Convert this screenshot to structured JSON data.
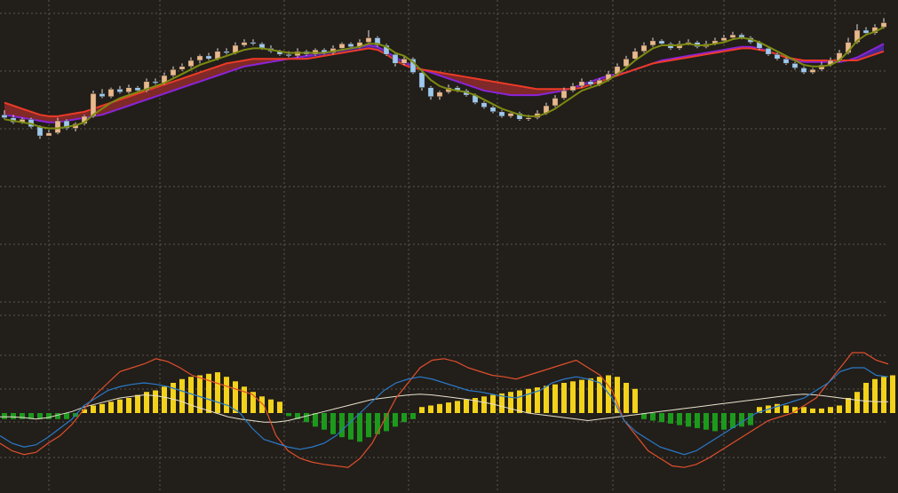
{
  "colors": {
    "background": "#221e1a",
    "grid": "#5a5550",
    "candle_up": "#e8b98c",
    "candle_down": "#9ec8ee",
    "wick": "#e0e0e0",
    "ma_fast": "#7d8a10",
    "band_upper": "#ee3a26",
    "band_lower": "#8a24d8",
    "band_fill_red": "#8a2a2a",
    "band_fill_blue": "#4a2aa0",
    "hist_pos": "#f2d21a",
    "hist_neg": "#1c9a1c",
    "line_red": "#e0502c",
    "line_blue": "#2a7ac8",
    "line_white": "#e8e2cc"
  },
  "chart_data": [
    {
      "type": "candlestick",
      "panel": "price",
      "grid": true,
      "x_count": 100,
      "ylim": [
        0,
        100
      ],
      "candles": [
        [
          62,
          61,
          63.5,
          60.5
        ],
        [
          61,
          59.5,
          62,
          59
        ],
        [
          59.5,
          60.5,
          61,
          59
        ],
        [
          60.5,
          58,
          61,
          57.5
        ],
        [
          58,
          55,
          58.5,
          54
        ],
        [
          55,
          56,
          57,
          55
        ],
        [
          56,
          60,
          61,
          55.5
        ],
        [
          60,
          57.5,
          60.5,
          57
        ],
        [
          57.5,
          59,
          59.5,
          56.5
        ],
        [
          59,
          61.5,
          62,
          58.5
        ],
        [
          61.5,
          69,
          70,
          61
        ],
        [
          69,
          68,
          70.5,
          67.5
        ],
        [
          68,
          70.5,
          71,
          67.5
        ],
        [
          70.5,
          69.5,
          71.5,
          69
        ],
        [
          69.5,
          71,
          72,
          69
        ],
        [
          71,
          70,
          71.5,
          69.5
        ],
        [
          70,
          73,
          74,
          69.5
        ],
        [
          73,
          72.5,
          74,
          72
        ],
        [
          72.5,
          75,
          76,
          72
        ],
        [
          75,
          77,
          78,
          74.5
        ],
        [
          77,
          78,
          79,
          76.5
        ],
        [
          78,
          80,
          81,
          77.5
        ],
        [
          80,
          81.5,
          82,
          79
        ],
        [
          81.5,
          80.5,
          82.5,
          80
        ],
        [
          80.5,
          83,
          84,
          80
        ],
        [
          83,
          82.5,
          84,
          82
        ],
        [
          82.5,
          85,
          86,
          82
        ],
        [
          85,
          86,
          87,
          84.5
        ],
        [
          86,
          85.5,
          87,
          85
        ],
        [
          85.5,
          84,
          86,
          83.5
        ],
        [
          84,
          83,
          85,
          82.5
        ],
        [
          83,
          82,
          83.5,
          81.5
        ],
        [
          82,
          81.5,
          83,
          81
        ],
        [
          81.5,
          83,
          84,
          81
        ],
        [
          83,
          82,
          83.5,
          81.5
        ],
        [
          82,
          83.5,
          84,
          81.5
        ],
        [
          83.5,
          82.5,
          84,
          82
        ],
        [
          82.5,
          84,
          85,
          82
        ],
        [
          84,
          85.5,
          86,
          83.5
        ],
        [
          85.5,
          84.5,
          86,
          84
        ],
        [
          84.5,
          86,
          87,
          84
        ],
        [
          86,
          87.5,
          90,
          85.5
        ],
        [
          87.5,
          85,
          88,
          84.5
        ],
        [
          85,
          82,
          85.5,
          81.5
        ],
        [
          82,
          79,
          82.5,
          78
        ],
        [
          79,
          80.5,
          81.5,
          78.5
        ],
        [
          80.5,
          76,
          81,
          75.5
        ],
        [
          76,
          71,
          76.5,
          70
        ],
        [
          71,
          68,
          71.5,
          67
        ],
        [
          68,
          69.5,
          70,
          67
        ],
        [
          69.5,
          71,
          72,
          69
        ],
        [
          71,
          70,
          71.5,
          69.5
        ],
        [
          70,
          68.5,
          70.5,
          68
        ],
        [
          68.5,
          66,
          69,
          65.5
        ],
        [
          66,
          64.5,
          66.5,
          64
        ],
        [
          64.5,
          63,
          65,
          62.5
        ],
        [
          63,
          61.5,
          63.5,
          61
        ],
        [
          61.5,
          62.5,
          63,
          61
        ],
        [
          62.5,
          60.5,
          63,
          60
        ],
        [
          60.5,
          61,
          62,
          60
        ],
        [
          61,
          62.5,
          63.5,
          60.5
        ],
        [
          62.5,
          65,
          66,
          62
        ],
        [
          65,
          67.5,
          68.5,
          64.5
        ],
        [
          67.5,
          70,
          71,
          67
        ],
        [
          70,
          71.5,
          72.5,
          69.5
        ],
        [
          71.5,
          73,
          74,
          71
        ],
        [
          73,
          72,
          73.5,
          71.5
        ],
        [
          72,
          73.5,
          74,
          71.5
        ],
        [
          73.5,
          75.5,
          76.5,
          73
        ],
        [
          75.5,
          78,
          79,
          75
        ],
        [
          78,
          80.5,
          81.5,
          77.5
        ],
        [
          80.5,
          83,
          84,
          80
        ],
        [
          83,
          85,
          86,
          82.5
        ],
        [
          85,
          86.5,
          87.5,
          84.5
        ],
        [
          86.5,
          85.5,
          87,
          85
        ],
        [
          85.5,
          84,
          86,
          83.5
        ],
        [
          84,
          85.5,
          86.5,
          83.5
        ],
        [
          85.5,
          86,
          87,
          85
        ],
        [
          86,
          84.5,
          86.5,
          84
        ],
        [
          84.5,
          85.5,
          86.5,
          84
        ],
        [
          85.5,
          86.5,
          87.5,
          85
        ],
        [
          86.5,
          87.5,
          88.5,
          86
        ],
        [
          87.5,
          88.5,
          89.5,
          87
        ],
        [
          88.5,
          87.5,
          89,
          87
        ],
        [
          87.5,
          86,
          88,
          85.5
        ],
        [
          86,
          84,
          86.5,
          83.5
        ],
        [
          84,
          82,
          84.5,
          81.5
        ],
        [
          82,
          80.5,
          82.5,
          80
        ],
        [
          80.5,
          79,
          81,
          78.5
        ],
        [
          79,
          77.5,
          79.5,
          77
        ],
        [
          77.5,
          76,
          78,
          75.5
        ],
        [
          76,
          77,
          77.5,
          75.5
        ],
        [
          77,
          78.5,
          79.5,
          76.5
        ],
        [
          78.5,
          80,
          81,
          78
        ],
        [
          80,
          82.5,
          83.5,
          79.5
        ],
        [
          82.5,
          86,
          87.5,
          82
        ],
        [
          86,
          90,
          92,
          85.5
        ],
        [
          90,
          89,
          91,
          88.5
        ],
        [
          89,
          91,
          92,
          88.5
        ],
        [
          91,
          92.5,
          94,
          90.5
        ]
      ],
      "ma_fast": [
        60.5,
        60,
        59.5,
        59,
        58,
        57.5,
        57.5,
        58,
        58.5,
        59.5,
        62,
        64,
        66,
        67.5,
        68.5,
        69.5,
        70.5,
        71.5,
        72.5,
        74,
        75.5,
        77,
        78.5,
        79.5,
        80.5,
        81.5,
        82.5,
        83.5,
        84,
        84,
        83.5,
        83,
        82.5,
        82.5,
        82.5,
        82.5,
        82.5,
        83,
        83.5,
        84,
        84.5,
        85.5,
        85.5,
        84.5,
        82.5,
        81.5,
        79.5,
        76.5,
        73.5,
        71.5,
        70.5,
        70,
        69.5,
        68.5,
        67,
        65.5,
        64,
        63,
        62,
        61.5,
        61.5,
        62.5,
        64,
        66,
        68,
        70,
        71,
        72,
        73.5,
        75.5,
        77.5,
        80,
        82,
        84,
        85,
        85,
        85,
        85.5,
        85,
        85,
        85.5,
        86,
        87,
        87.5,
        87,
        86,
        84.5,
        83,
        81.5,
        80,
        78.5,
        78,
        78,
        78.5,
        80,
        83,
        86.5,
        88.5,
        89.5,
        91
      ],
      "band_upper": [
        66,
        65,
        64,
        63,
        62,
        61.5,
        61.5,
        62,
        62.5,
        63,
        64,
        65,
        66,
        67,
        68,
        69,
        70,
        71,
        72,
        73,
        74,
        75,
        76,
        77,
        78,
        79,
        79.5,
        80,
        80.5,
        80.5,
        80.5,
        80.5,
        80.5,
        80.5,
        80.5,
        81,
        81.5,
        82,
        82.5,
        83,
        83.5,
        84,
        83.5,
        82,
        80,
        78.5,
        77.5,
        77,
        76.5,
        76,
        75.5,
        75,
        74.5,
        74,
        73.5,
        73,
        72.5,
        72,
        71.5,
        71,
        70.5,
        70.5,
        70.5,
        70.5,
        70.5,
        71,
        72,
        73,
        74,
        75,
        76,
        77,
        78,
        79,
        79.5,
        80,
        80.5,
        81,
        81.5,
        82,
        82.5,
        83,
        83.5,
        84,
        84,
        83.5,
        83,
        82,
        81,
        80.5,
        80,
        80,
        80,
        80,
        80,
        80,
        80,
        81,
        82,
        83
      ],
      "band_lower": [
        62,
        61.5,
        61,
        60.5,
        60,
        59.5,
        59.5,
        60,
        60.5,
        61,
        61.5,
        62,
        63,
        64,
        65,
        66,
        67,
        68,
        69,
        70,
        71,
        72,
        73,
        74,
        75,
        76,
        77,
        78,
        78.5,
        79,
        79.5,
        80,
        80.5,
        81,
        81.5,
        82,
        82.5,
        83,
        83.5,
        84,
        84.5,
        85,
        84.5,
        83,
        81,
        79.5,
        78,
        77,
        76,
        75,
        74,
        73,
        72,
        71,
        70,
        69.5,
        69,
        68.5,
        68.5,
        68.5,
        68.5,
        69,
        69.5,
        70,
        71,
        72,
        73,
        74,
        75,
        75.5,
        76,
        77,
        78,
        79,
        80,
        80.5,
        81,
        81.5,
        82,
        82.5,
        83,
        83.5,
        84,
        84.5,
        84.5,
        84,
        83,
        82,
        81,
        80,
        79.5,
        79.5,
        79.5,
        79.5,
        79.5,
        80,
        81,
        82.5,
        84,
        85.5
      ]
    },
    {
      "type": "histogram+line",
      "panel": "oscillator",
      "grid": true,
      "x_count": 100,
      "ylim": [
        -100,
        100
      ],
      "histogram": [
        -8,
        -8,
        -8,
        -8,
        -8,
        -8,
        -8,
        -8,
        -5,
        5,
        10,
        12,
        15,
        18,
        20,
        24,
        28,
        30,
        35,
        40,
        45,
        48,
        50,
        52,
        54,
        48,
        42,
        35,
        28,
        22,
        18,
        15,
        -4,
        -8,
        -12,
        -18,
        -22,
        -28,
        -32,
        -35,
        -38,
        -32,
        -28,
        -24,
        -18,
        -12,
        -8,
        8,
        10,
        12,
        14,
        16,
        18,
        20,
        22,
        24,
        26,
        28,
        30,
        32,
        34,
        36,
        38,
        40,
        42,
        44,
        46,
        48,
        50,
        48,
        40,
        32,
        -8,
        -10,
        -12,
        -14,
        -16,
        -18,
        -20,
        -22,
        -24,
        -22,
        -20,
        -18,
        -16,
        8,
        10,
        12,
        10,
        8,
        8,
        6,
        6,
        8,
        10,
        20,
        28,
        40,
        45,
        48,
        50
      ],
      "line_red": [
        -40,
        -50,
        -55,
        -52,
        -40,
        -30,
        -15,
        5,
        25,
        40,
        55,
        60,
        65,
        72,
        68,
        60,
        50,
        45,
        40,
        35,
        30,
        25,
        10,
        -30,
        -50,
        -60,
        -65,
        -68,
        -70,
        -72,
        -60,
        -40,
        -10,
        20,
        40,
        60,
        70,
        72,
        68,
        60,
        55,
        50,
        48,
        45,
        50,
        55,
        60,
        65,
        70,
        60,
        50,
        30,
        -10,
        -30,
        -50,
        -60,
        -70,
        -72,
        -68,
        -60,
        -50,
        -40,
        -30,
        -20,
        -10,
        -5,
        0,
        10,
        20,
        40,
        60,
        80,
        80,
        70,
        65
      ],
      "line_blue": [
        -30,
        -40,
        -45,
        -42,
        -32,
        -20,
        -8,
        10,
        20,
        30,
        35,
        38,
        40,
        38,
        35,
        30,
        25,
        20,
        15,
        10,
        0,
        -20,
        -35,
        -40,
        -45,
        -48,
        -45,
        -40,
        -30,
        -15,
        0,
        15,
        30,
        40,
        45,
        48,
        45,
        40,
        35,
        30,
        28,
        25,
        22,
        20,
        25,
        30,
        40,
        45,
        48,
        45,
        40,
        20,
        -10,
        -25,
        -35,
        -45,
        -50,
        -55,
        -50,
        -40,
        -30,
        -20,
        -10,
        0,
        5,
        10,
        15,
        20,
        30,
        40,
        55,
        60,
        60,
        50,
        48
      ],
      "line_white": [
        -5,
        -5,
        -6,
        -8,
        -6,
        -2,
        2,
        8,
        12,
        16,
        20,
        22,
        24,
        23,
        20,
        16,
        10,
        5,
        0,
        -5,
        -8,
        -10,
        -12,
        -12,
        -10,
        -6,
        -2,
        2,
        6,
        10,
        14,
        18,
        20,
        22,
        24,
        25,
        24,
        22,
        20,
        18,
        15,
        12,
        8,
        4,
        0,
        -2,
        -4,
        -6,
        -8,
        -10,
        -8,
        -6,
        -4,
        -2,
        0,
        2,
        4,
        6,
        8,
        10,
        12,
        14,
        16,
        18,
        20,
        22,
        24,
        25,
        24,
        22,
        20,
        18,
        16,
        15,
        15
      ]
    }
  ]
}
